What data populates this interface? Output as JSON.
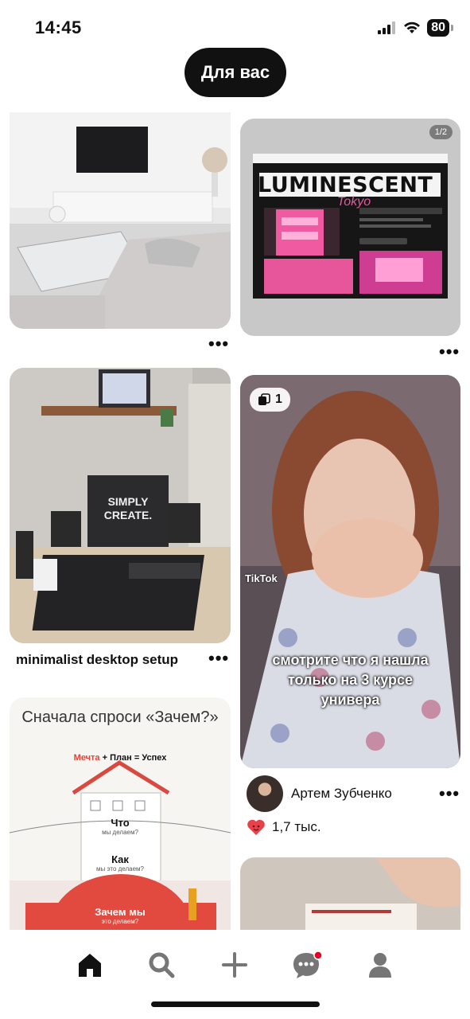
{
  "status_bar": {
    "time": "14:45",
    "battery": "80"
  },
  "header": {
    "tab_label": "Для вас"
  },
  "pins": {
    "living_room": {
      "more": "•••"
    },
    "luminescent": {
      "page_badge": "1/2",
      "headline": "LUMINESCENT",
      "script_text": "Tokyo",
      "more": "•••"
    },
    "desk": {
      "title": "minimalist desktop setup",
      "monitor_text": "SIMPLY\nCREATE.",
      "more": "•••"
    },
    "tiktok": {
      "multi_count": "1",
      "watermark": "TikTok",
      "caption_lines": [
        "смотрите что я нашла",
        "только на 3 курсе",
        "универа"
      ],
      "author": "Артем Зубченко",
      "likes": "1,7 тыс.",
      "more": "•••"
    },
    "infographic": {
      "title": "Сначала спроси «Зачем?»",
      "equation_a": "Мечта",
      "equation_plus": "+",
      "equation_b": "План",
      "equation_eq": "= Успех",
      "label_what": "Что",
      "label_what_sub": "мы делаем?",
      "label_how": "Как",
      "label_how_sub": "мы это делаем?",
      "label_why": "Зачем мы",
      "label_why_sub": "это делаем?"
    }
  },
  "colors": {
    "accent_red": "#e60023",
    "pill_bg": "#111111",
    "like_heart": "#e8414a"
  },
  "bottom_nav": [
    {
      "name": "home",
      "icon": "home-icon"
    },
    {
      "name": "search",
      "icon": "search-icon"
    },
    {
      "name": "create",
      "icon": "plus-icon"
    },
    {
      "name": "messages",
      "icon": "chat-icon"
    },
    {
      "name": "profile",
      "icon": "profile-icon"
    }
  ]
}
